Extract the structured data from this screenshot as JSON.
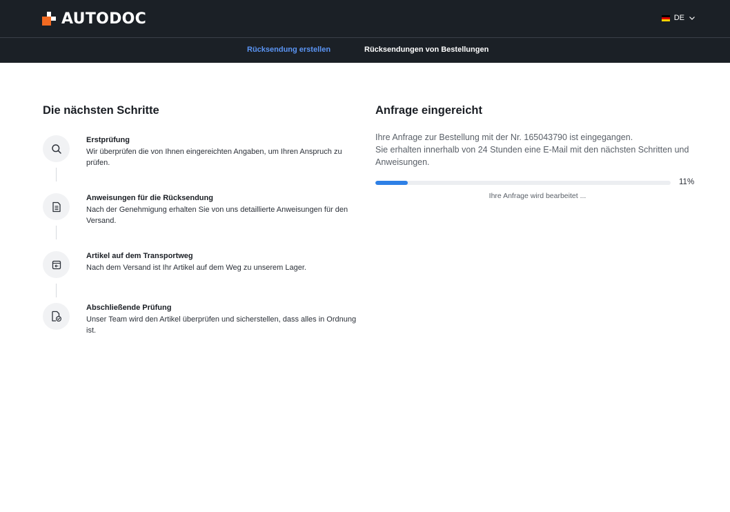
{
  "header": {
    "logo_text": "AUTODOC",
    "language": "DE",
    "flag_colors": [
      "#000000",
      "#dd0000",
      "#ffce00"
    ],
    "accent_color": "#f26a21"
  },
  "subnav": {
    "tabs": [
      {
        "label": "Rücksendung erstellen",
        "active": true
      },
      {
        "label": "Rücksendungen von Bestellungen",
        "active": false
      }
    ]
  },
  "steps": {
    "title": "Die nächsten Schritte",
    "items": [
      {
        "icon": "search-icon",
        "title": "Erstprüfung",
        "desc": "Wir überprüfen die von Ihnen eingereichten Angaben, um Ihren Anspruch zu prüfen."
      },
      {
        "icon": "document-icon",
        "title": "Anweisungen für die Rücksendung",
        "desc": "Nach der Genehmigung erhalten Sie von uns detaillierte Anweisungen für den Versand."
      },
      {
        "icon": "return-box-icon",
        "title": "Artikel auf dem Transportweg",
        "desc": "Nach dem Versand ist Ihr Artikel auf dem Weg zu unserem Lager."
      },
      {
        "icon": "document-check-icon",
        "title": "Abschließende Prüfung",
        "desc": "Unser Team wird den Artikel überprüfen und sicherstellen, dass alles in Ordnung ist."
      }
    ]
  },
  "request": {
    "title": "Anfrage eingereicht",
    "line1": "Ihre Anfrage zur Bestellung mit der Nr. 165043790 ist eingegangen.",
    "line2": "Sie erhalten innerhalb von 24 Stunden eine E-Mail mit den nächsten Schritten und Anweisungen.",
    "progress_percent": 11,
    "progress_label": "11%",
    "status_text": "Ihre Anfrage wird bearbeitet ...",
    "progress_color": "#2e80e6"
  }
}
